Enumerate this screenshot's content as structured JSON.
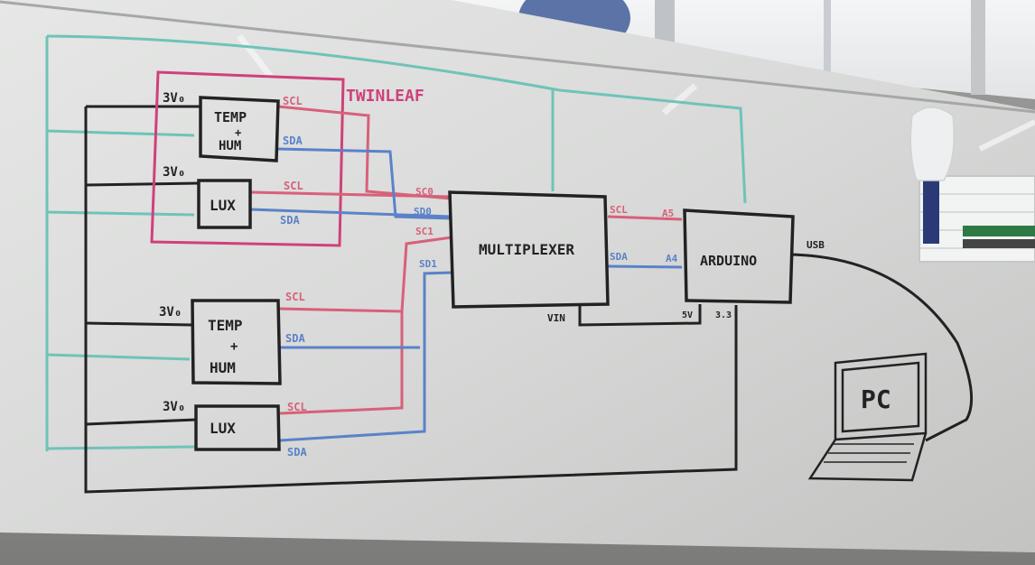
{
  "board": {
    "colors": {
      "black": "#222222",
      "red": "#d8607a",
      "blue": "#5b82c9",
      "teal": "#6fc3b8",
      "magenta": "#d0407a"
    }
  },
  "group_label": "TWINLEAF",
  "sensors": [
    {
      "label_line1": "TEMP",
      "label_line2": "+",
      "label_line3": "HUM",
      "voltage": "3V₀",
      "scl": "SCL",
      "sda": "SDA"
    },
    {
      "label_line1": "LUX",
      "voltage": "3V₀",
      "scl": "SCL",
      "sda": "SDA"
    },
    {
      "label_line1": "TEMP",
      "label_line2": "+",
      "label_line3": "HUM",
      "voltage": "3V₀",
      "scl": "SCL",
      "sda": "SDA"
    },
    {
      "label_line1": "LUX",
      "voltage": "3V₀",
      "scl": "SCL",
      "sda": "SDA"
    }
  ],
  "multiplexer": {
    "label": "MULTIPLEXER",
    "port_sc0": "SC0",
    "port_sd0": "SD0",
    "port_sc1": "SC1",
    "port_sd1": "SD1",
    "port_sda_out": "SDA",
    "port_scl_out": "SCL",
    "vin": "VIN"
  },
  "arduino": {
    "label": "ARDUINO",
    "pin_a5": "A5",
    "pin_a4": "A4",
    "pin_5v": "5V",
    "pin_3v3": "3.3",
    "usb": "USB"
  },
  "pc": {
    "label": "PC"
  }
}
